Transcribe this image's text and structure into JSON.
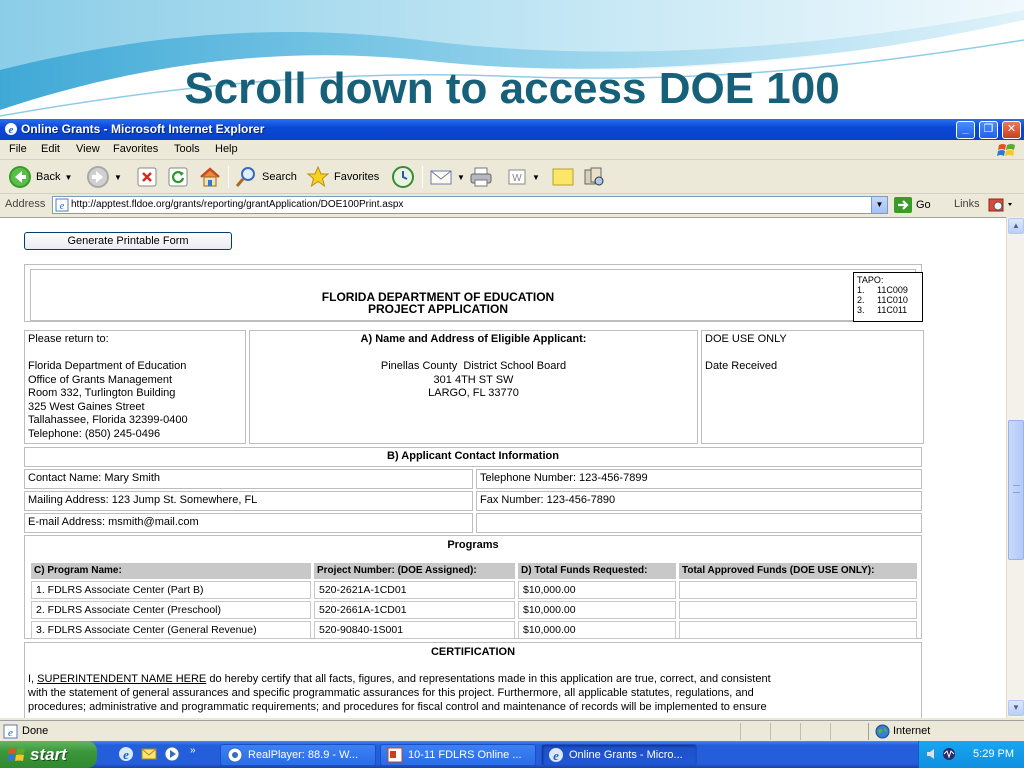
{
  "slide": {
    "title": "Scroll down to access DOE 100"
  },
  "window": {
    "title": "Online Grants - Microsoft Internet Explorer",
    "buttons": {
      "minimize": "_",
      "maximize": "❐",
      "close": "✕"
    }
  },
  "menu": {
    "items": [
      "File",
      "Edit",
      "View",
      "Favorites",
      "Tools",
      "Help"
    ]
  },
  "toolbar": {
    "back": "Back",
    "search": "Search",
    "favorites": "Favorites"
  },
  "address": {
    "label": "Address",
    "url": "http://apptest.fldoe.org/grants/reporting/grantApplication/DOE100Print.aspx",
    "go": "Go",
    "links": "Links"
  },
  "page": {
    "generate_button": "Generate Printable Form",
    "header": {
      "line1": "FLORIDA DEPARTMENT OF EDUCATION",
      "line2": "PROJECT APPLICATION",
      "tapo_label": "TAPO:",
      "tapo": [
        {
          "n": "1.",
          "code": "11C009"
        },
        {
          "n": "2.",
          "code": "11C010"
        },
        {
          "n": "3.",
          "code": "11C011"
        }
      ]
    },
    "return_to": {
      "label": "Please return to:",
      "lines": [
        "Florida Department of Education",
        "Office of Grants Management",
        "Room 332, Turlington Building",
        "325 West Gaines Street",
        "Tallahassee, Florida 32399-0400",
        "Telephone: (850) 245-0496"
      ]
    },
    "applicant": {
      "heading": "A) Name and Address of Eligible Applicant:",
      "lines": [
        "Pinellas County  District School Board",
        "301 4TH ST SW",
        "LARGO, FL 33770"
      ]
    },
    "doe_use": {
      "label": "DOE USE ONLY",
      "date_received": "Date Received"
    },
    "contact": {
      "heading": "B) Applicant Contact Information",
      "name": "Contact Name: Mary Smith",
      "phone": "Telephone Number: 123-456-7899",
      "mailing": "Mailing Address: 123 Jump St. Somewhere, FL",
      "fax": "Fax Number: 123-456-7890",
      "email": "E-mail Address: msmith@mail.com"
    },
    "programs": {
      "heading": "Programs",
      "columns": [
        "C) Program Name:",
        "Project Number: (DOE Assigned):",
        "D) Total Funds Requested:",
        "Total Approved Funds (DOE USE ONLY):"
      ],
      "rows": [
        [
          "1. FDLRS Associate Center (Part B)",
          "520-2621A-1CD01",
          "$10,000.00",
          ""
        ],
        [
          "2. FDLRS Associate Center (Preschool)",
          "520-2661A-1CD01",
          "$10,000.00",
          ""
        ],
        [
          "3. FDLRS Associate Center (General Revenue)",
          "520-90840-1S001",
          "$10,000.00",
          ""
        ]
      ]
    },
    "certification": {
      "heading": "CERTIFICATION",
      "prefix": "I, ",
      "name_placeholder": "SUPERINTENDENT NAME HERE",
      "line1_rest": " do hereby certify that all facts, figures, and representations made in this application are true, correct, and consistent",
      "line2": "with the statement of general assurances and specific programmatic assurances for this project. Furthermore, all applicable statutes, regulations, and",
      "line3": "procedures; administrative and programmatic requirements; and procedures for fiscal control and maintenance of records will be implemented to ensure"
    }
  },
  "status": {
    "text": "Done",
    "zone": "Internet"
  },
  "taskbar": {
    "start": "start",
    "tasks": [
      {
        "label": "RealPlayer: 88.9 - W...",
        "active": false
      },
      {
        "label": "10-11 FDLRS Online ...",
        "active": false
      },
      {
        "label": "Online Grants - Micro...",
        "active": true
      }
    ],
    "clock": "5:29 PM"
  },
  "colors": {
    "title_blue": "#17607a",
    "xp_blue": "#245edb",
    "start_green": "#3c963c"
  }
}
